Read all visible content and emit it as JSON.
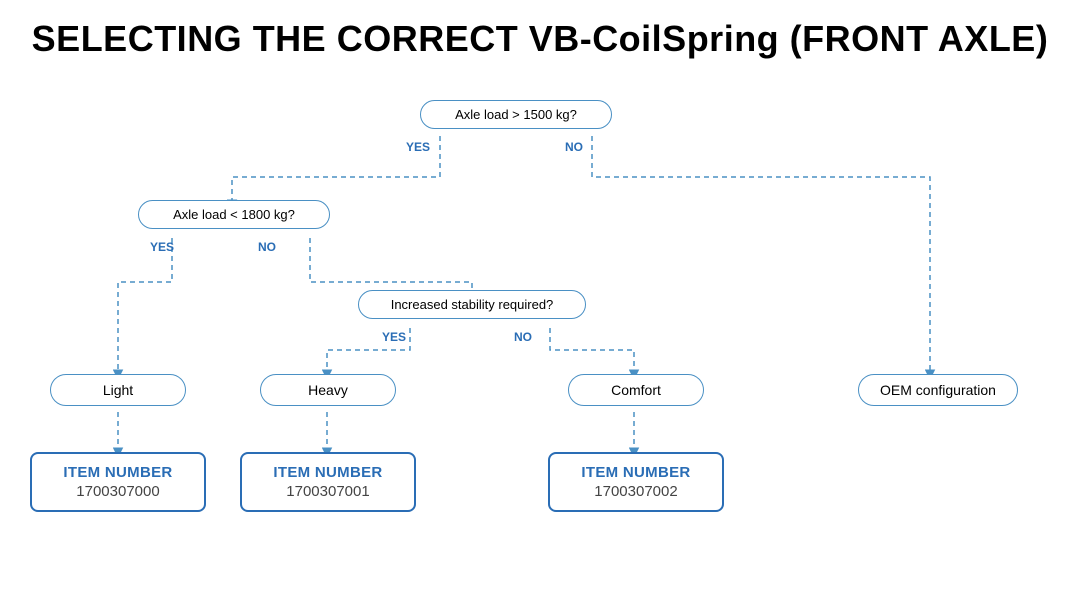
{
  "title": "SELECTING THE CORRECT VB-CoilSpring (FRONT AXLE)",
  "diagram": {
    "decision1": {
      "text": "Axle load > 1500 kg?",
      "yes": "YES",
      "no": "NO"
    },
    "decision2": {
      "text": "Axle load < 1800 kg?",
      "yes": "YES",
      "no": "NO"
    },
    "decision3": {
      "text": "Increased stability required?",
      "yes": "YES",
      "no": "NO"
    },
    "results": [
      {
        "label": "Light",
        "id": "light"
      },
      {
        "label": "Heavy",
        "id": "heavy"
      },
      {
        "label": "Comfort",
        "id": "comfort"
      },
      {
        "label": "OEM configuration",
        "id": "oem"
      }
    ],
    "items": [
      {
        "label": "ITEM NUMBER",
        "number": "1700307000"
      },
      {
        "label": "ITEM NUMBER",
        "number": "1700307001"
      },
      {
        "label": "ITEM NUMBER",
        "number": "1700307002"
      }
    ]
  }
}
